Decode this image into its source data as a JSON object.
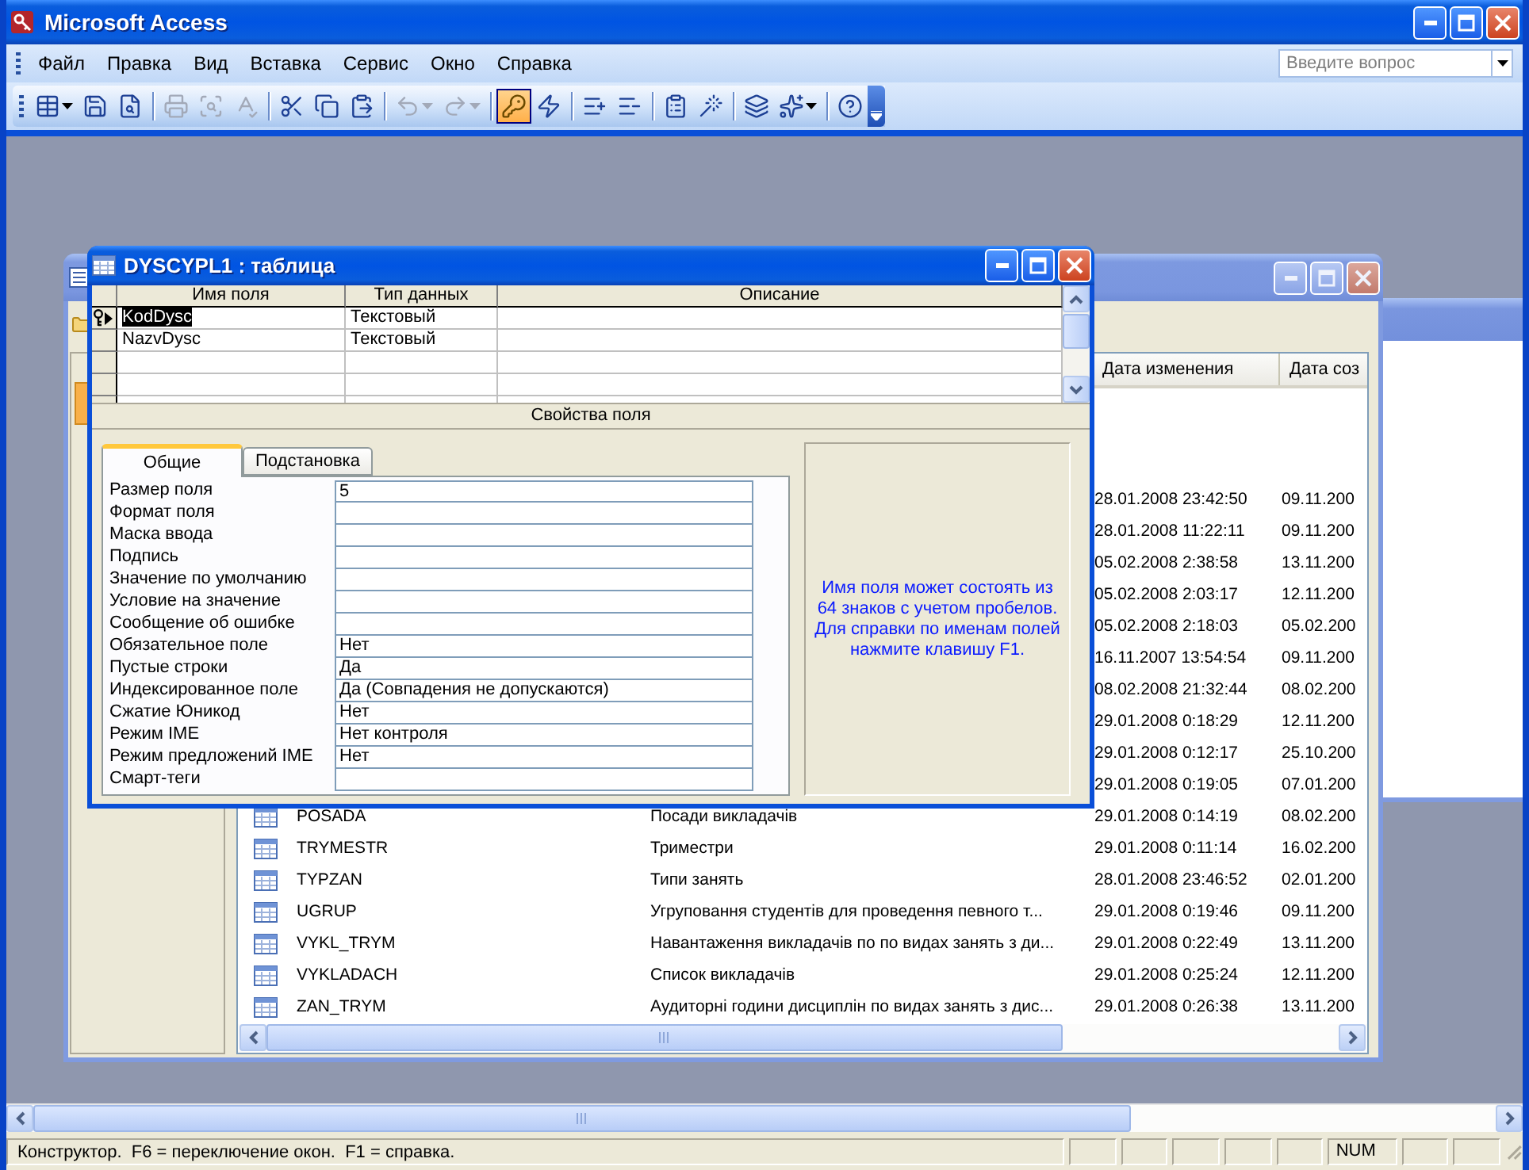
{
  "window": {
    "title": "Microsoft Access"
  },
  "menu": [
    "Файл",
    "Правка",
    "Вид",
    "Вставка",
    "Сервис",
    "Окно",
    "Справка"
  ],
  "help_search": {
    "placeholder": "Введите вопрос"
  },
  "toolbar": [
    {
      "disabled": false,
      "pressed": false
    },
    {
      "disabled": false,
      "pressed": false
    },
    {
      "disabled": false,
      "pressed": false
    },
    {
      "disabled": true,
      "pressed": false
    },
    {
      "disabled": true,
      "pressed": false
    },
    {
      "disabled": true,
      "pressed": false
    },
    {
      "disabled": false,
      "pressed": false
    },
    {
      "disabled": false,
      "pressed": false
    },
    {
      "disabled": false,
      "pressed": false
    },
    {
      "disabled": true,
      "pressed": false
    },
    {
      "disabled": true,
      "pressed": false
    },
    {
      "disabled": false,
      "pressed": true
    },
    {
      "disabled": false,
      "pressed": false
    },
    {
      "disabled": false,
      "pressed": false
    },
    {
      "disabled": false,
      "pressed": false
    },
    {
      "disabled": false,
      "pressed": false
    },
    {
      "disabled": false,
      "pressed": false
    },
    {
      "disabled": false,
      "pressed": false
    },
    {
      "disabled": false,
      "pressed": false
    },
    {
      "disabled": false,
      "pressed": false
    }
  ],
  "design_window": {
    "title": "DYSCYPL1 : таблица",
    "columns": [
      "Имя поля",
      "Тип данных",
      "Описание"
    ],
    "fields": [
      {
        "name": "KodDysc",
        "type": "Текстовый",
        "primary_key": true,
        "selected": true
      },
      {
        "name": "NazvDysc",
        "type": "Текстовый",
        "primary_key": false,
        "selected": false
      }
    ],
    "section_title": "Свойства поля",
    "tabs": [
      {
        "label": "Общие",
        "selected": true
      },
      {
        "label": "Подстановка",
        "selected": false
      }
    ],
    "properties": [
      {
        "label": "Размер поля",
        "value": "5"
      },
      {
        "label": "Формат поля"
      },
      {
        "label": "Маска ввода"
      },
      {
        "label": "Подпись"
      },
      {
        "label": "Значение по умолчанию"
      },
      {
        "label": "Условие на значение"
      },
      {
        "label": "Сообщение об ошибке"
      },
      {
        "label": "Обязательное поле",
        "value": "Нет"
      },
      {
        "label": "Пустые строки",
        "value": "Да"
      },
      {
        "label": "Индексированное поле",
        "value": "Да (Совпадения не допускаются)"
      },
      {
        "label": "Сжатие Юникод",
        "value": "Нет"
      },
      {
        "label": "Режим IME",
        "value": "Нет контроля"
      },
      {
        "label": "Режим предложений IME",
        "value": "Нет"
      },
      {
        "label": "Смарт-теги"
      }
    ],
    "help_text": "Имя поля может состоять из 64 знаков с учетом пробелов. Для справки по именам полей нажмите клавишу F1."
  },
  "database_window": {
    "columns": [
      "Дата изменения",
      "Дата соз"
    ],
    "rows": [
      {
        "modified": "28.01.2008 23:42:50",
        "created": "09.11.200"
      },
      {
        "modified": "28.01.2008 11:22:11",
        "created": "09.11.200"
      },
      {
        "modified": "05.02.2008 2:38:58",
        "created": "13.11.200"
      },
      {
        "modified": "05.02.2008 2:03:17",
        "created": "12.11.200"
      },
      {
        "modified": "05.02.2008 2:18:03",
        "created": "05.02.200"
      },
      {
        "modified": "16.11.2007 13:54:54",
        "created": "09.11.200"
      },
      {
        "modified": "08.02.2008 21:32:44",
        "created": "08.02.200"
      },
      {
        "modified": "29.01.2008 0:18:29",
        "created": "12.11.200"
      },
      {
        "modified": "29.01.2008 0:12:17",
        "created": "25.10.200"
      },
      {
        "modified": "29.01.2008 0:19:05",
        "created": "07.01.200"
      },
      {
        "name": "POSADA",
        "description": "Посади викладачів",
        "modified": "29.01.2008 0:14:19",
        "created": "08.02.200"
      },
      {
        "name": "TRYMESTR",
        "description": "Триместри",
        "modified": "29.01.2008 0:11:14",
        "created": "16.02.200"
      },
      {
        "name": "TYPZAN",
        "description": "Типи занять",
        "modified": "28.01.2008 23:46:52",
        "created": "02.01.200"
      },
      {
        "name": "UGRUP",
        "description": "Угруповання студентів для проведення певного т...",
        "modified": "29.01.2008 0:19:46",
        "created": "09.11.200"
      },
      {
        "name": "VYKL_TRYM",
        "description": "Навантаження викладачів по по видах занять з ди...",
        "modified": "29.01.2008 0:22:49",
        "created": "13.11.200"
      },
      {
        "name": "VYKLADACH",
        "description": "Список викладачів",
        "modified": "29.01.2008 0:25:24",
        "created": "12.11.200"
      },
      {
        "name": "ZAN_TRYM",
        "description": "Аудиторні години дисциплін по видах занять з дис...",
        "modified": "29.01.2008 0:26:38",
        "created": "13.11.200"
      }
    ]
  },
  "status_bar": {
    "text": "Конструктор.  F6 = переключение окон.  F1 = справка.",
    "num_indicator": "NUM"
  }
}
